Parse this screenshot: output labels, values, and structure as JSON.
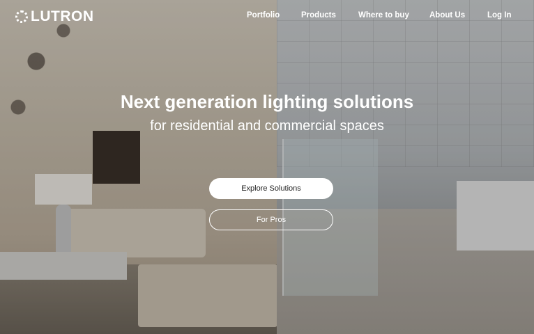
{
  "brand": {
    "name": "LUTRON",
    "logo_icon": "lutron-burst-icon"
  },
  "nav": {
    "items": [
      {
        "label": "Portfolio"
      },
      {
        "label": "Products"
      },
      {
        "label": "Where to buy"
      },
      {
        "label": "About Us"
      },
      {
        "label": "Log In"
      }
    ]
  },
  "hero": {
    "title": "Next generation lighting solutions",
    "subtitle": "for residential and commercial spaces",
    "primary_button": "Explore Solutions",
    "secondary_button": "For Pros"
  },
  "colors": {
    "text": "#ffffff",
    "primary_button_bg": "#ffffff"
  }
}
